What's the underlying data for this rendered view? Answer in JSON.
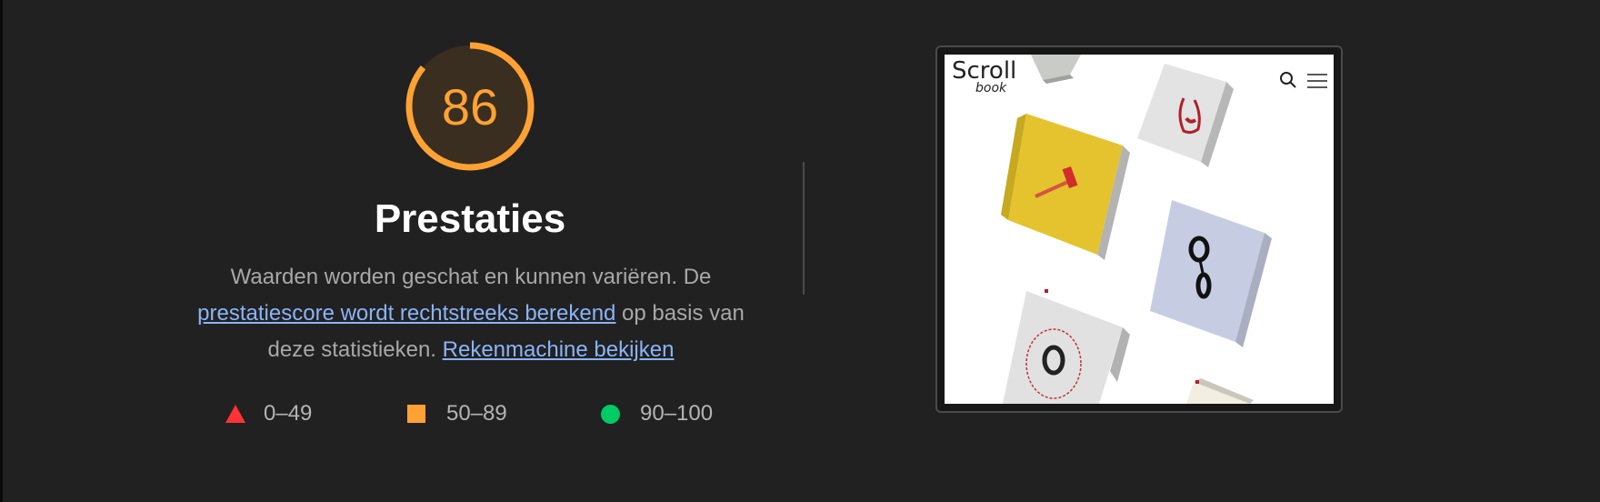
{
  "score": {
    "value": "86",
    "fraction": 0.86,
    "color": "#ffa233"
  },
  "category": {
    "title": "Prestaties"
  },
  "description": {
    "text1": "Waarden worden geschat en kunnen variëren. De ",
    "link1": "prestatiescore wordt rechtstreeks berekend",
    "text2": " op basis van deze statistieken. ",
    "link2": "Rekenmachine bekijken"
  },
  "legend": [
    {
      "label": "0–49",
      "icon": "triangle-icon",
      "color": "#ff3333"
    },
    {
      "label": "50–89",
      "icon": "square-icon",
      "color": "#ffa233"
    },
    {
      "label": "90–100",
      "icon": "circle-icon",
      "color": "#00cc66"
    }
  ],
  "screenshot": {
    "logo_top": "Scroll",
    "logo_sub": "book",
    "icons": [
      "search-icon",
      "hamburger-menu-icon"
    ]
  }
}
